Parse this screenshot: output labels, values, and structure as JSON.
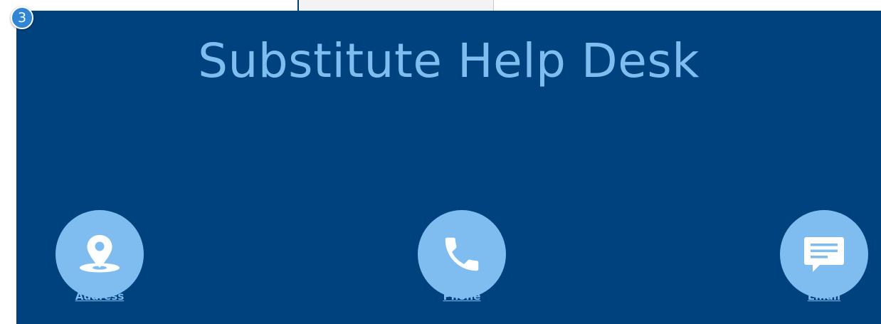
{
  "badge": {
    "number": "3"
  },
  "header": {
    "title": "Substitute Help Desk"
  },
  "contacts": [
    {
      "label": "Address",
      "icon": "map-pin-icon"
    },
    {
      "label": "Phone",
      "icon": "phone-icon"
    },
    {
      "label": "Email",
      "icon": "chat-message-icon"
    }
  ],
  "colors": {
    "panel": "#00427e",
    "accent": "#7fbdf1",
    "badge": "#2f86d6",
    "icon": "#ffffff"
  }
}
